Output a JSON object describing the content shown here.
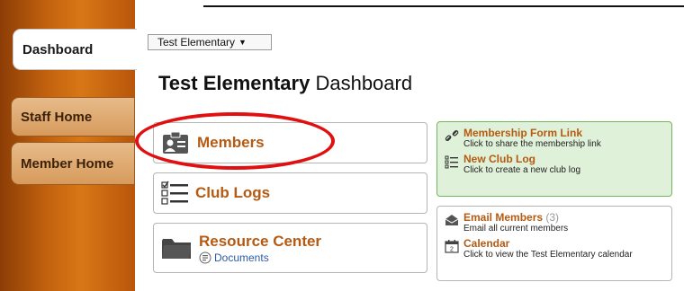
{
  "sidebar": {
    "tabs": [
      {
        "label": "Dashboard"
      },
      {
        "label": "Staff Home"
      },
      {
        "label": "Member Home"
      }
    ]
  },
  "header": {
    "school_select": "Test Elementary",
    "title_bold": "Test Elementary",
    "title_rest": " Dashboard"
  },
  "cards": {
    "members": "Members",
    "club_logs": "Club Logs",
    "resource_center": "Resource Center",
    "documents": "Documents"
  },
  "panels": {
    "membership_link": {
      "title": "Membership Form Link",
      "desc": "Click to share the membership link"
    },
    "new_club_log": {
      "title": "New Club Log",
      "desc": "Click to create a new club log"
    },
    "email_members": {
      "title": "Email Members",
      "count": "(3)",
      "desc": "Email all current members"
    },
    "calendar": {
      "title": "Calendar",
      "desc": "Click to view the Test Elementary calendar"
    }
  },
  "colors": {
    "accent": "#b55a12",
    "sidebar": "#c2620f",
    "green_panel": "#dff1d8",
    "annotation": "#e01010"
  },
  "icons": [
    "members-icon",
    "checklist-icon",
    "folder-icon",
    "document-icon",
    "link-icon",
    "list-icon",
    "envelope-icon",
    "calendar-icon"
  ]
}
